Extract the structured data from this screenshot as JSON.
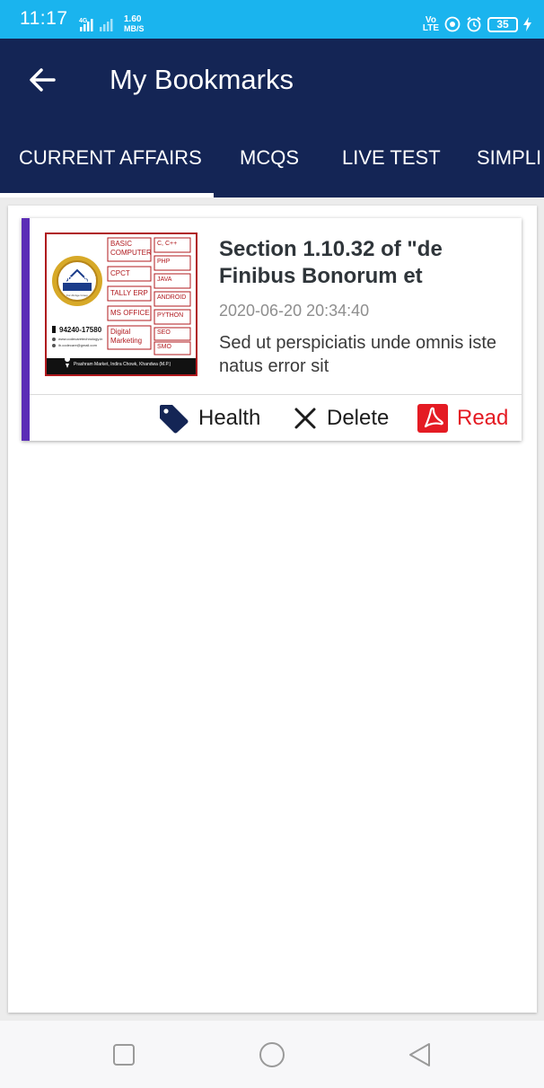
{
  "status_bar": {
    "time": "11:17",
    "network": "4G",
    "speed_value": "1.60",
    "speed_unit": "MB/S",
    "volte_top": "Vo",
    "volte_bottom": "LTE",
    "battery": "35"
  },
  "app_bar": {
    "title": "My Bookmarks"
  },
  "tabs": [
    {
      "label": "CURRENT AFFAIRS",
      "selected": true
    },
    {
      "label": "MCQS",
      "selected": false
    },
    {
      "label": "LIVE TEST",
      "selected": false
    },
    {
      "label": "SIMPLI",
      "selected": false
    }
  ],
  "bookmark": {
    "title": "Section 1.10.32 of \"de Finibus Bonorum et",
    "date": "2020-06-20 20:34:40",
    "description": "Sed ut perspiciatis unde omnis iste natus error sit",
    "thumbnail": {
      "brand": "CODE CARE",
      "brand_sub": "For All Age Group",
      "courses_left": [
        "BASIC COMPUTER",
        "CPCT",
        "TALLY ERP",
        "MS OFFICE",
        "Digital Marketing"
      ],
      "courses_right": [
        "C, C++",
        "PHP",
        "JAVA",
        "ANDROID",
        "PYTHON",
        "SEO",
        "SMO"
      ],
      "phone": "94240-17580",
      "web": "www.codecaretechnology.in",
      "email": "ib.codecare@gmail.com",
      "address": "Prashram Market, Indira Chowk, Khandwa (M.P.)"
    },
    "actions": {
      "tag_label": "Health",
      "delete_label": "Delete",
      "read_label": "Read"
    }
  },
  "colors": {
    "status_bar": "#1ab4ee",
    "app_bar": "#142555",
    "card_accent": "#5b2db6",
    "read_red": "#e41b23",
    "tag_icon": "#142555"
  }
}
